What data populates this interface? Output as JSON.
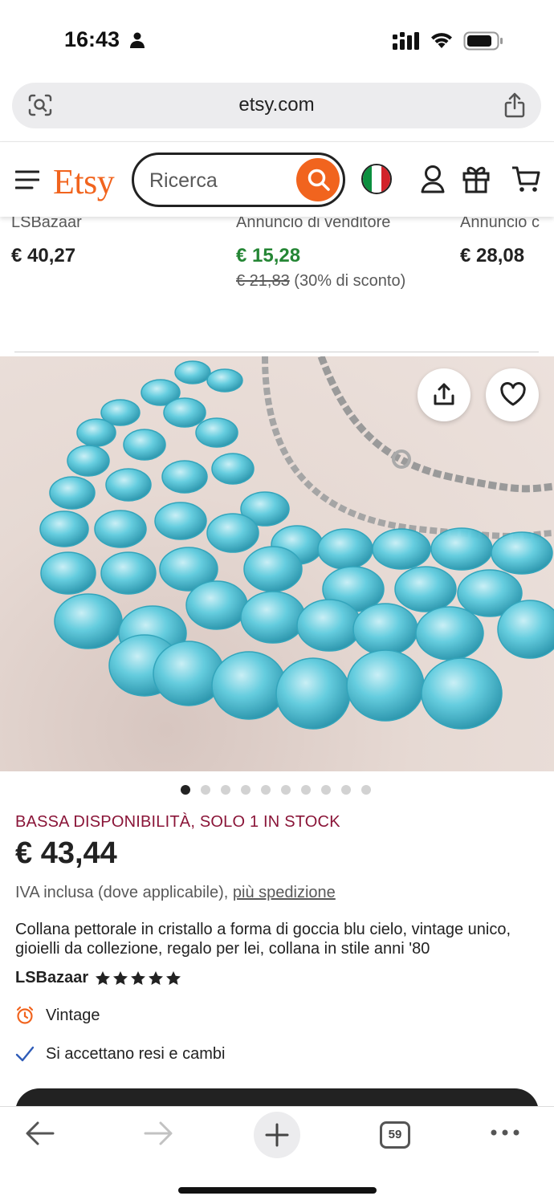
{
  "status_bar": {
    "time": "16:43"
  },
  "browser": {
    "url": "etsy.com",
    "tab_count": "59"
  },
  "header": {
    "logo": "Etsy",
    "search_placeholder": "Ricerca"
  },
  "recommendations": [
    {
      "name": "LSBazaar",
      "price": "€ 40,27"
    },
    {
      "name": "Annuncio di venditore",
      "price": "€ 15,28",
      "original_price": "€ 21,83",
      "discount": "(30% di sconto)"
    },
    {
      "name": "Annuncio c",
      "price": "€ 28,08"
    }
  ],
  "gallery": {
    "image_count": 10,
    "active_index": 0
  },
  "product": {
    "stock_notice": "BASSA DISPONIBILITÀ, SOLO 1 IN STOCK",
    "price": "€ 43,44",
    "vat_text": "IVA inclusa (dove applicabile),",
    "shipping_link": "più spedizione",
    "title": "Collana pettorale in cristallo a forma di goccia blu cielo, vintage unico, gioielli da collezione, regalo per lei, collana in stile anni '80",
    "shop_name": "LSBazaar",
    "rating": 5,
    "features": [
      {
        "icon": "alarm-clock-icon",
        "label": "Vintage"
      },
      {
        "icon": "checkmark-icon",
        "label": "Si accettano resi e cambi"
      }
    ]
  },
  "colors": {
    "etsy_orange": "#f1641e",
    "sale_green": "#258635",
    "stock_red": "#8a1538"
  }
}
